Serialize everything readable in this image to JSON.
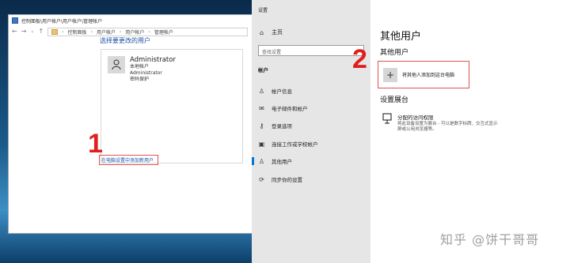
{
  "control_panel": {
    "window_title": "控制面板\\用户帐户\\用户帐户\\管理帐户",
    "breadcrumb": [
      "控制面板",
      "用户帐户",
      "用户帐户",
      "管理帐户"
    ],
    "heading": "选择要更改的用户",
    "account": {
      "name": "Administrator",
      "lines": [
        "本地帐户",
        "Administrator",
        "密码保护"
      ]
    },
    "add_user_link": "在电脑设置中添加新用户",
    "annotation": "1"
  },
  "settings": {
    "app_title": "设置",
    "home_label": "主页",
    "search_placeholder": "查找设置",
    "category": "帐户",
    "nav": [
      {
        "label": "帐户信息",
        "icon": "person-icon"
      },
      {
        "label": "电子邮件和帐户",
        "icon": "mail-icon"
      },
      {
        "label": "登录选项",
        "icon": "key-icon"
      },
      {
        "label": "连接工作或学校帐户",
        "icon": "briefcase-icon"
      },
      {
        "label": "其他用户",
        "icon": "people-icon"
      },
      {
        "label": "同步你的设置",
        "icon": "sync-icon"
      }
    ],
    "active_nav": "其他用户",
    "page_title": "其他用户",
    "section1": "其他用户",
    "add_other_label": "将其他人添加到这台电脑",
    "annotation": "2",
    "section2": "设置展台",
    "kiosk_title": "分配的访问权限",
    "kiosk_desc": "将此设备设置为展台 - 可以是数字标牌、交互式显示屏或公用浏览器等。"
  },
  "watermark": "知乎 @饼干哥哥"
}
